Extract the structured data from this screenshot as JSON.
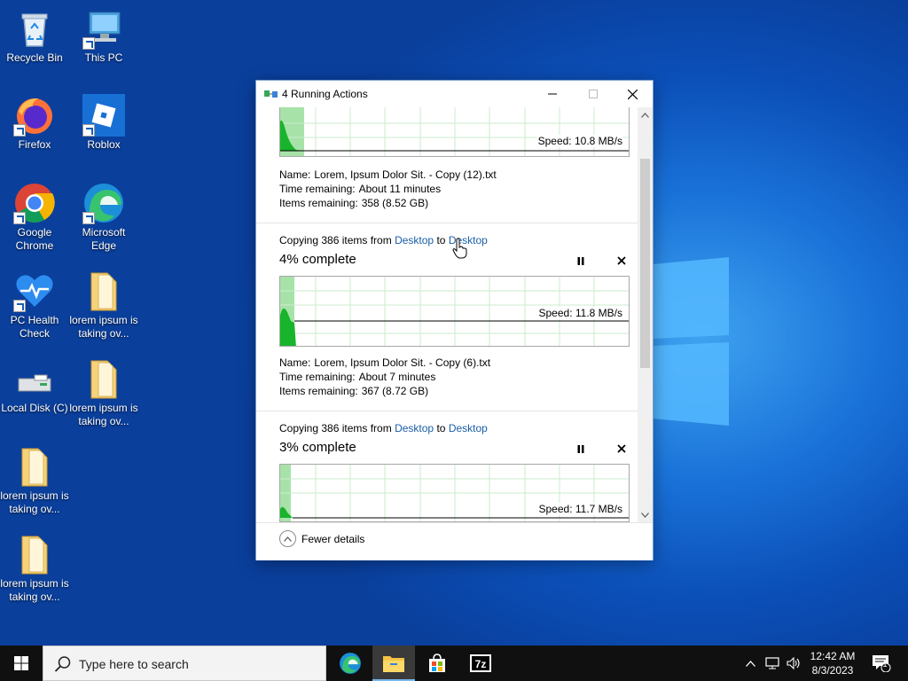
{
  "desktop": {
    "icons": [
      {
        "label": "Recycle Bin"
      },
      {
        "label": "This PC"
      },
      {
        "label": "Firefox"
      },
      {
        "label": "Roblox"
      },
      {
        "label": "Google Chrome"
      },
      {
        "label": "Microsoft Edge"
      },
      {
        "label": "PC Health Check"
      },
      {
        "label": "lorem ipsum is taking ov..."
      },
      {
        "label": "Local Disk (C)"
      },
      {
        "label": "lorem ipsum is taking ov..."
      },
      {
        "label": "lorem ipsum is taking ov..."
      },
      {
        "label": "lorem ipsum is taking ov..."
      }
    ]
  },
  "dialog": {
    "title": "4 Running Actions",
    "footer_label": "Fewer details",
    "ops": [
      {
        "speed": "Speed: 10.8 MB/s",
        "name_key": "Name:",
        "name_val": "Lorem, Ipsum Dolor Sit. - Copy (12).txt",
        "time_key": "Time remaining:",
        "time_val": "About 11 minutes",
        "items_key": "Items remaining:",
        "items_val": "358 (8.52 GB)"
      },
      {
        "copy_prefix": "Copying 386 items from",
        "from": "Desktop",
        "to_word": "to",
        "to": "Desktop",
        "percent": "4% complete",
        "progress": 0.04,
        "speed": "Speed: 11.8 MB/s",
        "name_key": "Name:",
        "name_val": "Lorem, Ipsum Dolor Sit. - Copy (6).txt",
        "time_key": "Time remaining:",
        "time_val": "About 7 minutes",
        "items_key": "Items remaining:",
        "items_val": "367 (8.72 GB)"
      },
      {
        "copy_prefix": "Copying 386 items from",
        "from": "Desktop",
        "to_word": "to",
        "to": "Desktop",
        "percent": "3% complete",
        "progress": 0.03,
        "speed": "Speed: 11.7 MB/s"
      }
    ]
  },
  "taskbar": {
    "search_placeholder": "Type here to search",
    "time": "12:42 AM",
    "date": "8/3/2023",
    "notification_count": "1",
    "apps": [
      "edge-icon",
      "file-explorer-icon",
      "store-icon",
      "7zip-icon"
    ]
  },
  "colors": {
    "accent_link": "#1a5ea8",
    "graph_green": "#18b42c",
    "graph_grid": "#bfe6c0"
  }
}
